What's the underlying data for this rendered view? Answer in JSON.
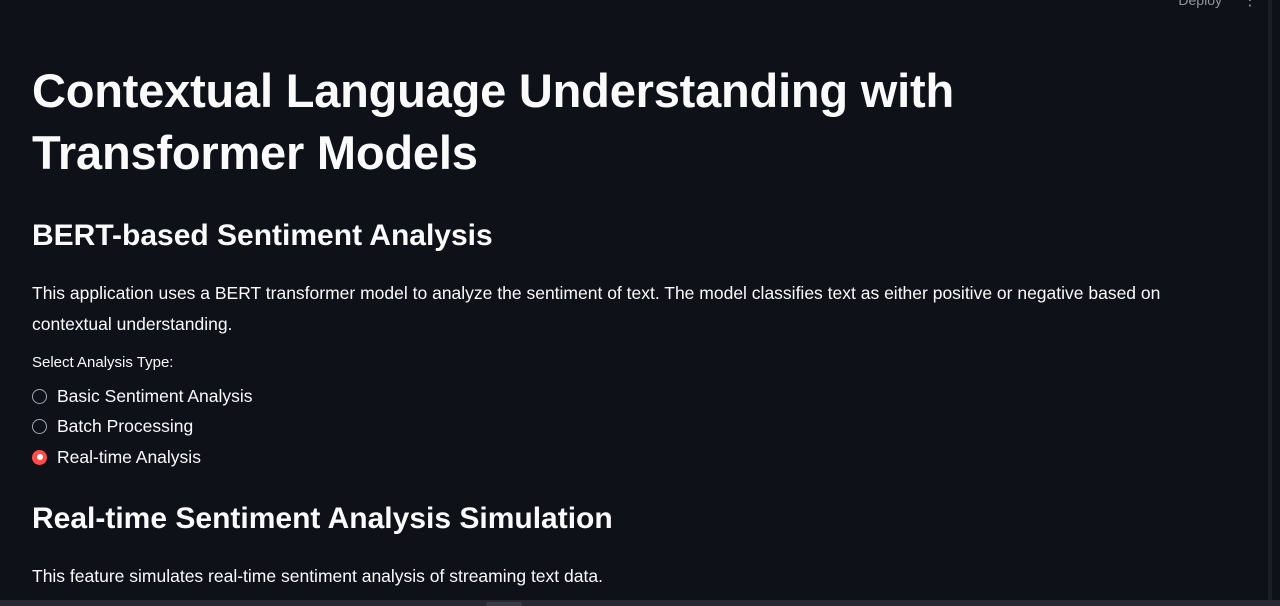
{
  "header": {
    "deploy_label": "Deploy",
    "menu_icon": "kebab-menu-icon"
  },
  "main": {
    "title": "Contextual Language Understanding with Transformer Models",
    "section1_title": "BERT-based Sentiment Analysis",
    "section1_description": "This application uses a BERT transformer model to analyze the sentiment of text. The model classifies text as either positive or negative based on contextual understanding.",
    "analysis_type": {
      "label": "Select Analysis Type:",
      "options": [
        {
          "label": "Basic Sentiment Analysis",
          "selected": false
        },
        {
          "label": "Batch Processing",
          "selected": false
        },
        {
          "label": "Real-time Analysis",
          "selected": true
        }
      ]
    },
    "section2_title": "Real-time Sentiment Analysis Simulation",
    "section2_description": "This feature simulates real-time sentiment analysis of streaming text data."
  },
  "colors": {
    "background": "#0e1117",
    "text": "#fafafa",
    "accent": "#ff4b4b"
  }
}
